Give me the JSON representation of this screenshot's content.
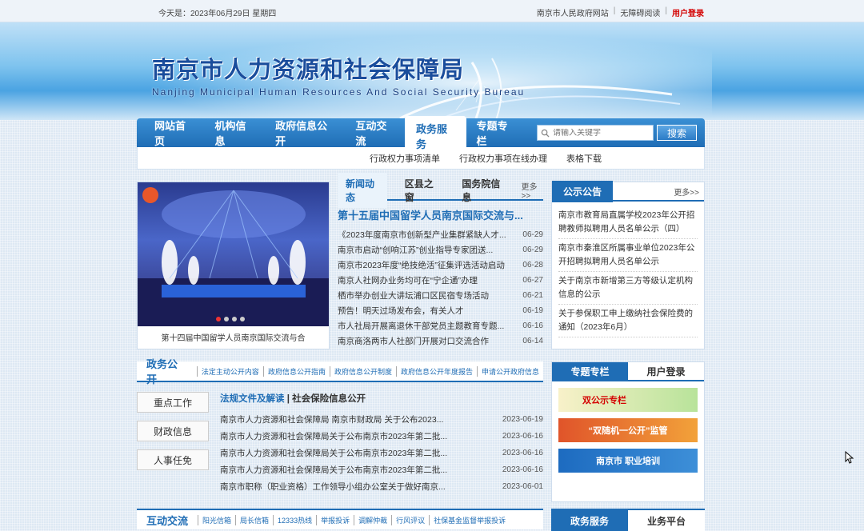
{
  "topbar": {
    "date": "今天是：2023年06月29日 星期四",
    "links": [
      "南京市人民政府网站",
      "无障碍阅读"
    ],
    "login": "用户登录"
  },
  "banner": {
    "title_cn": "南京市人力资源和社会保障局",
    "title_en": "Nanjing Municipal Human Resources And Social Security Bureau"
  },
  "nav": {
    "items": [
      "网站首页",
      "机构信息",
      "政府信息公开",
      "互动交流",
      "政务服务",
      "专题专栏"
    ],
    "active": "政务服务",
    "search_placeholder": "请输入关键字",
    "search_button": "搜索",
    "sub_items": [
      "行政权力事项清单",
      "行政权力事项在线办理",
      "表格下载"
    ]
  },
  "slide": {
    "caption": "第十四届中国留学人员南京国际交流与合"
  },
  "news": {
    "tabs": [
      "新闻动态",
      "区县之窗",
      "国务院信息"
    ],
    "more": "更多>>",
    "headline": "第十五届中国留学人员南京国际交流与...",
    "items": [
      {
        "title": "《2023年度南京市创新型产业集群紧缺人才...",
        "date": "06-29"
      },
      {
        "title": "南京市启动“创响江苏”创业指导专家团送...",
        "date": "06-29"
      },
      {
        "title": "南京市2023年度“绝技绝活”征集评选活动启动",
        "date": "06-28"
      },
      {
        "title": "南京人社网办业务均可在“宁企通”办理",
        "date": "06-27"
      },
      {
        "title": "栖市举办创业大讲坛浦口区民宿专场活动",
        "date": "06-21"
      },
      {
        "title": "预告！明天过场发布会，有关人才",
        "date": "06-19"
      },
      {
        "title": "市人社局开展离退休干部党员主题教育专题...",
        "date": "06-16"
      },
      {
        "title": "南京商洛两市人社部门开展对口交流合作",
        "date": "06-14"
      }
    ]
  },
  "notice": {
    "title": "公示公告",
    "more": "更多>>",
    "items": [
      "南京市教育局直属学校2023年公开招聘教师拟聘用人员名单公示（四）",
      "南京市秦淮区所属事业单位2023年公开招聘拟聘用人员名单公示",
      "关于南京市新增第三方等级认定机构信息的公示",
      "关于参保职工申上缴纳社会保险费的通知（2023年6月）"
    ]
  },
  "gov": {
    "title": "政务公开",
    "links": [
      "法定主动公开内容",
      "政府信息公开指南",
      "政府信息公开制度",
      "政府信息公开年度报告",
      "申请公开政府信息"
    ],
    "side": [
      "重点工作",
      "财政信息",
      "人事任免"
    ],
    "sub_a": "法规文件及解读",
    "sub_sep": "|",
    "sub_b": "社会保险信息公开",
    "items": [
      {
        "title": "南京市人力资源和社会保障局 南京市财政局 关于公布2023...",
        "date": "2023-06-19"
      },
      {
        "title": "南京市人力资源和社会保障局关于公布南京市2023年第二批...",
        "date": "2023-06-16"
      },
      {
        "title": "南京市人力资源和社会保障局关于公布南京市2023年第二批...",
        "date": "2023-06-16"
      },
      {
        "title": "南京市人力资源和社会保障局关于公布南京市2023年第二批...",
        "date": "2023-06-16"
      },
      {
        "title": "南京市职称（职业资格）工作领导小组办公室关于做好南京...",
        "date": "2023-06-01"
      }
    ]
  },
  "special": {
    "tabs": [
      "专题专栏",
      "用户登录"
    ],
    "banners": [
      "双公示专栏",
      "“双随机一公开”监管",
      "南京市 职业培训"
    ]
  },
  "interact": {
    "title": "互动交流",
    "links": [
      "阳光信箱",
      "局长信箱",
      "12333热线",
      "举报投诉",
      "调解仲裁",
      "行风评议",
      "社保基金监督举报投诉"
    ]
  },
  "bottom_right": {
    "tabs": [
      "政务服务",
      "业务平台"
    ]
  }
}
